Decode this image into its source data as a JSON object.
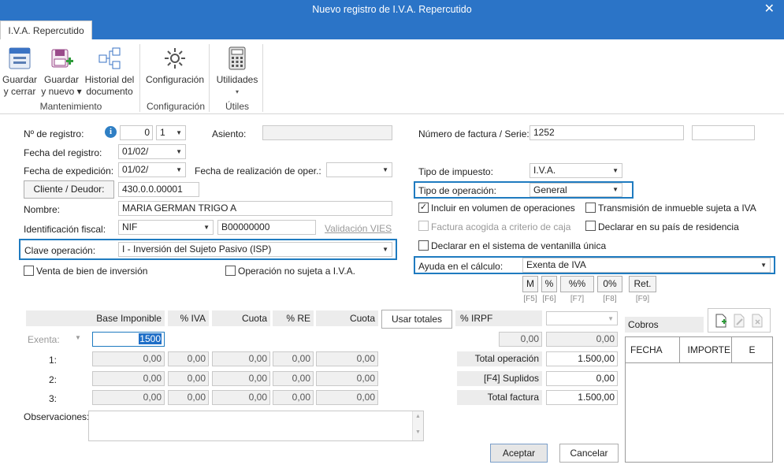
{
  "window": {
    "title": "Nuevo registro de I.V.A. Repercutido",
    "close_glyph": "✕"
  },
  "ribbon": {
    "tab": "I.V.A. Repercutido",
    "buttons": {
      "guardar_cerrar": [
        "Guardar",
        "y cerrar"
      ],
      "guardar_nuevo": [
        "Guardar",
        "y nuevo ▾"
      ],
      "historial": [
        "Historial del",
        "documento"
      ],
      "configuracion": [
        "Configuración"
      ],
      "utilidades": [
        "Utilidades",
        "▾"
      ]
    },
    "groups": {
      "mantenimiento": "Mantenimiento",
      "configuracion": "Configuración",
      "utiles": "Útiles"
    }
  },
  "form": {
    "num_registro_label": "Nº de registro:",
    "num_registro_value": "0",
    "num_registro_serie": "1",
    "asiento_label": "Asiento:",
    "asiento_value": "",
    "fecha_registro_label": "Fecha del registro:",
    "fecha_registro_value": "01/02/",
    "fecha_expedicion_label": "Fecha de expedición:",
    "fecha_expedicion_value": "01/02/",
    "fecha_realizacion_label": "Fecha de realización de oper.:",
    "fecha_realizacion_value": "",
    "cliente_button": "Cliente / Deudor:",
    "cliente_value": "430.0.0.00001",
    "nombre_label": "Nombre:",
    "nombre_value": "MARIA GERMAN TRIGO A",
    "id_fiscal_label": "Identificación fiscal:",
    "id_fiscal_type": "NIF",
    "id_fiscal_value": "B00000000",
    "validacion_vies": "Validación VIES",
    "clave_label": "Clave operación:",
    "clave_value": "I - Inversión del Sujeto Pasivo (ISP)",
    "venta_bien_label": "Venta de bien de inversión",
    "operacion_no_sujeta_label": "Operación no sujeta a I.V.A.",
    "num_factura_label": "Número de factura / Serie:",
    "num_factura_value": "1252",
    "serie_value": "",
    "tipo_impuesto_label": "Tipo de impuesto:",
    "tipo_impuesto_value": "I.V.A.",
    "tipo_operacion_label": "Tipo de operación:",
    "tipo_operacion_value": "General",
    "incluir_volumen_label": "Incluir en volumen de operaciones",
    "incluir_volumen_checked": "✓",
    "transmision_label": "Transmisión de inmueble sujeta a IVA",
    "factura_caja_label": "Factura acogida a criterio de caja",
    "declarar_pais_label": "Declarar en su país de residencia",
    "ventanilla_label": "Declarar en el sistema de ventanilla única",
    "ayuda_label": "Ayuda en el cálculo:",
    "ayuda_value": "Exenta de IVA",
    "calc_buttons": [
      {
        "label": "M",
        "key": "[F5]"
      },
      {
        "label": "%",
        "key": "[F6]"
      },
      {
        "label": "%%",
        "key": "[F7]"
      },
      {
        "label": "0%",
        "key": "[F8]"
      },
      {
        "label": "Ret.",
        "key": "[F9]"
      }
    ]
  },
  "table": {
    "headers": [
      "Base Imponible",
      "% IVA",
      "Cuota",
      "% RE",
      "Cuota"
    ],
    "usar_totales": "Usar totales",
    "irpf_label": "% IRPF",
    "exenta_label": "Exenta:",
    "exenta_base": "1500",
    "rows": [
      {
        "label": "1:",
        "values": [
          "0,00",
          "0,00",
          "0,00",
          "0,00",
          "0,00"
        ]
      },
      {
        "label": "2:",
        "values": [
          "0,00",
          "0,00",
          "0,00",
          "0,00",
          "0,00"
        ]
      },
      {
        "label": "3:",
        "values": [
          "0,00",
          "0,00",
          "0,00",
          "0,00",
          "0,00"
        ]
      }
    ],
    "irpf_pct": "0,00",
    "irpf_amount": "0,00",
    "total_operacion_label": "Total operación",
    "total_operacion_value": "1.500,00",
    "suplidos_label": "[F4] Suplidos",
    "suplidos_value": "0,00",
    "total_factura_label": "Total factura",
    "total_factura_value": "1.500,00"
  },
  "observaciones_label": "Observaciones:",
  "observaciones_value": "",
  "cobros": {
    "title": "Cobros",
    "columns": [
      "FECHA",
      "IMPORTE",
      "E"
    ]
  },
  "footer": {
    "aceptar": "Aceptar",
    "cancelar": "Cancelar"
  },
  "icons": {
    "info": "i",
    "dropdown": "▼",
    "check": "✓"
  },
  "colors": {
    "accent": "#2b74c7",
    "highlight_border": "#1f7bc0",
    "info_icon": "#2f7fc4"
  }
}
